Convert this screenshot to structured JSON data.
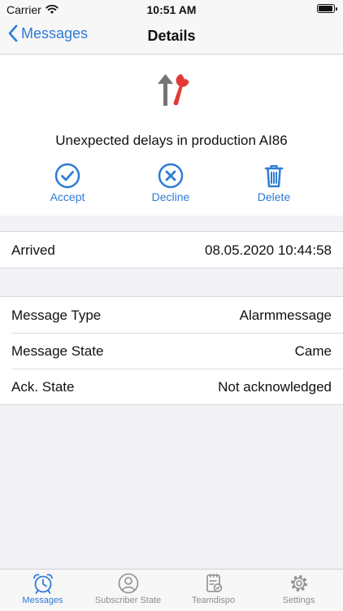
{
  "status": {
    "carrier": "Carrier",
    "time": "10:51 AM",
    "battery_level": 1.0
  },
  "nav": {
    "back_label": "Messages",
    "title": "Details"
  },
  "message": {
    "title": "Unexpected delays in production AI86",
    "actions": {
      "accept": "Accept",
      "decline": "Decline",
      "delete": "Delete"
    }
  },
  "arrival": {
    "label": "Arrived",
    "value": "08.05.2020 10:44:58"
  },
  "details": [
    {
      "label": "Message Type",
      "value": "Alarmmessage"
    },
    {
      "label": "Message State",
      "value": "Came"
    },
    {
      "label": "Ack. State",
      "value": "Not acknowledged"
    }
  ],
  "tabs": [
    {
      "label": "Messages",
      "icon": "alarm-clock-icon",
      "active": true
    },
    {
      "label": "Subscriber State",
      "icon": "person-icon",
      "active": false
    },
    {
      "label": "Teamdispo",
      "icon": "clipboard-icon",
      "active": false
    },
    {
      "label": "Settings",
      "icon": "gear-icon",
      "active": false
    }
  ],
  "colors": {
    "accent": "#2f7bd6",
    "alert_red": "#e53935",
    "arrow_gray": "#757575",
    "inactive": "#8e8e93"
  }
}
